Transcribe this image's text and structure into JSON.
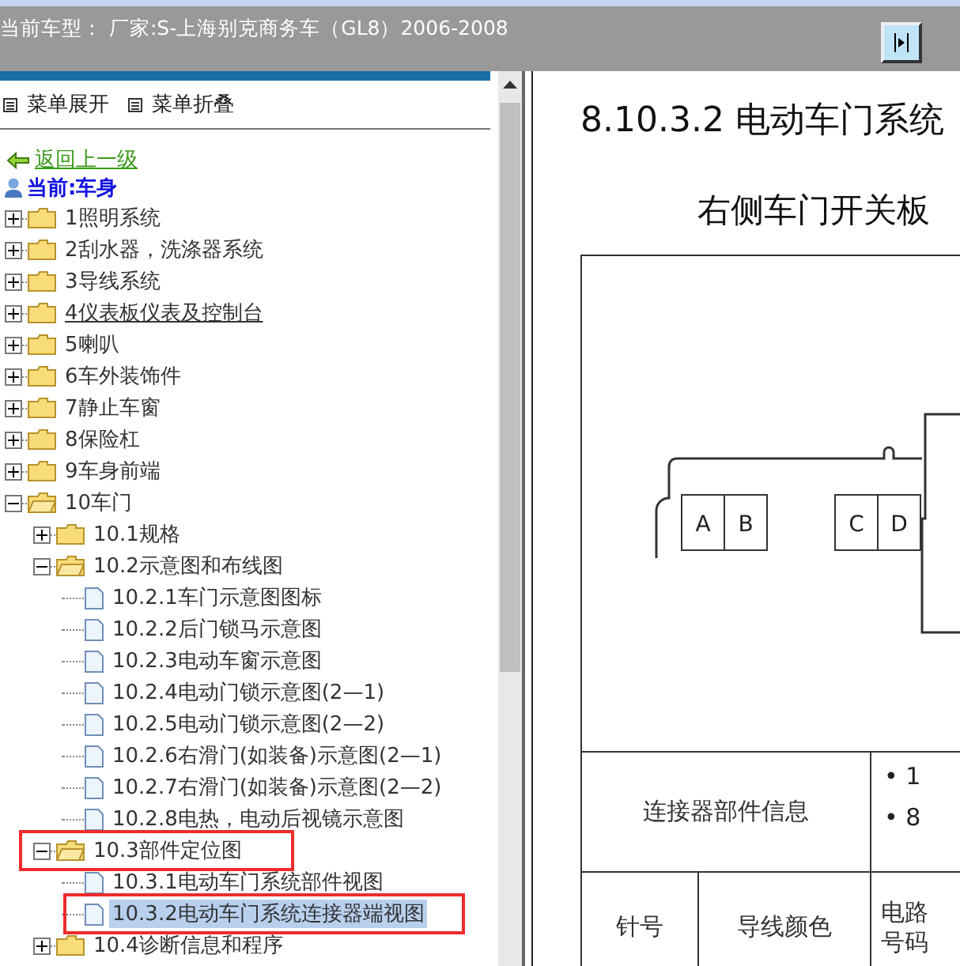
{
  "header": {
    "title": "当前车型： 厂家:S-上海别克商务车（GL8）2006-2008"
  },
  "menu": [
    {
      "label": "菜单展开"
    },
    {
      "label": "菜单折叠"
    }
  ],
  "back_link": "返回上一级",
  "current": "当前:车身",
  "tree": [
    {
      "label": "1照明系统",
      "kind": "folder",
      "expanded": false,
      "selected": false,
      "hovered": false,
      "marked": false
    },
    {
      "label": "2刮水器，洗涤器系统",
      "kind": "folder",
      "expanded": false,
      "selected": false,
      "hovered": false,
      "marked": false
    },
    {
      "label": "3导线系统",
      "kind": "folder",
      "expanded": false,
      "selected": false,
      "hovered": false,
      "marked": false
    },
    {
      "label": "4仪表板仪表及控制台",
      "kind": "folder",
      "expanded": false,
      "selected": false,
      "hovered": true,
      "marked": false
    },
    {
      "label": "5喇叭",
      "kind": "folder",
      "expanded": false,
      "selected": false,
      "hovered": false,
      "marked": false
    },
    {
      "label": "6车外装饰件",
      "kind": "folder",
      "expanded": false,
      "selected": false,
      "hovered": false,
      "marked": false
    },
    {
      "label": "7静止车窗",
      "kind": "folder",
      "expanded": false,
      "selected": false,
      "hovered": false,
      "marked": false
    },
    {
      "label": "8保险杠",
      "kind": "folder",
      "expanded": false,
      "selected": false,
      "hovered": false,
      "marked": false
    },
    {
      "label": "9车身前端",
      "kind": "folder",
      "expanded": false,
      "selected": false,
      "hovered": false,
      "marked": false
    },
    {
      "label": "10车门",
      "kind": "folder",
      "expanded": true,
      "selected": false,
      "hovered": false,
      "marked": false,
      "children": [
        {
          "label": "10.1规格",
          "kind": "folder",
          "expanded": false,
          "selected": false,
          "hovered": false,
          "marked": false
        },
        {
          "label": "10.2示意图和布线图",
          "kind": "folder",
          "expanded": true,
          "selected": false,
          "hovered": false,
          "marked": false,
          "children": [
            {
              "label": "10.2.1车门示意图图标",
              "kind": "page",
              "selected": false,
              "hovered": false,
              "marked": false
            },
            {
              "label": "10.2.2后门锁马示意图",
              "kind": "page",
              "selected": false,
              "hovered": false,
              "marked": false
            },
            {
              "label": "10.2.3电动车窗示意图",
              "kind": "page",
              "selected": false,
              "hovered": false,
              "marked": false
            },
            {
              "label": "10.2.4电动门锁示意图(2—1)",
              "kind": "page",
              "selected": false,
              "hovered": false,
              "marked": false
            },
            {
              "label": "10.2.5电动门锁示意图(2—2)",
              "kind": "page",
              "selected": false,
              "hovered": false,
              "marked": false
            },
            {
              "label": "10.2.6右滑门(如装备)示意图(2—1)",
              "kind": "page",
              "selected": false,
              "hovered": false,
              "marked": false
            },
            {
              "label": "10.2.7右滑门(如装备)示意图(2—2)",
              "kind": "page",
              "selected": false,
              "hovered": false,
              "marked": false
            },
            {
              "label": "10.2.8电热，电动后视镜示意图",
              "kind": "page",
              "selected": false,
              "hovered": false,
              "marked": false
            }
          ]
        },
        {
          "label": "10.3部件定位图",
          "kind": "folder",
          "expanded": true,
          "selected": false,
          "hovered": false,
          "marked": true,
          "children": [
            {
              "label": "10.3.1电动车门系统部件视图",
              "kind": "page",
              "selected": false,
              "hovered": false,
              "marked": false
            },
            {
              "label": "10.3.2电动车门系统连接器端视图",
              "kind": "page",
              "selected": true,
              "hovered": false,
              "marked": true
            }
          ]
        },
        {
          "label": "10.4诊断信息和程序",
          "kind": "folder",
          "expanded": false,
          "selected": false,
          "hovered": false,
          "marked": false
        }
      ]
    }
  ],
  "document": {
    "title": "8.10.3.2 电动车门系统",
    "subtitle": "右侧车门开关板",
    "connector_pins": [
      "A",
      "B",
      "C",
      "D"
    ],
    "info_label": "连接器部件信息",
    "info_bullets": [
      "• 1",
      "• 8"
    ],
    "columns": [
      "针号",
      "导线颜色",
      "电路号码"
    ]
  }
}
